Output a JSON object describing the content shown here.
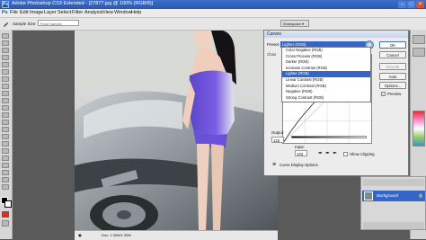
{
  "window": {
    "title": "Adobe Photoshop CS3 Extended - [27877.jpg @ 100% (RGB/8)]"
  },
  "menu": [
    "File",
    "Edit",
    "Image",
    "Layer",
    "Select",
    "Filter",
    "Analysis",
    "View",
    "Window",
    "Help"
  ],
  "options_bar": {
    "sample_size_label": "Sample Size:",
    "sample_size_value": "Point Sample",
    "workspace_label": "Workspace ▾"
  },
  "status_bar": {
    "doc_label": "Doc: 1.30M/1.30M"
  },
  "curves": {
    "title": "Curves",
    "preset_label": "Preset:",
    "preset_value": "Lighter (RGB)",
    "channel_label": "Chan",
    "preset_options": [
      "Color Negative (RGB)",
      "Cross Process (RGB)",
      "Darker (RGB)",
      "Increase Contrast (RGB)",
      "Lighter (RGB)",
      "Linear Contrast (RGB)",
      "Medium Contrast (RGB)",
      "Negative (RGB)",
      "Strong Contrast (RGB)"
    ],
    "selected_preset_index": 4,
    "buttons": {
      "ok": "OK",
      "cancel": "Cancel",
      "smooth": "Smooth",
      "auto": "Auto",
      "options": "Options..."
    },
    "preview_label": "Preview",
    "preview_checked": true,
    "output_label": "Output:",
    "output_value": "125",
    "input_label": "Input:",
    "input_value": "103",
    "show_clipping_label": "Show Clipping",
    "display_options_label": "Curve Display Options"
  },
  "layers": {
    "layer_name": "Background"
  },
  "colors": {
    "selection_blue": "#3466c8",
    "titlebar_blue": "#2b57b0"
  }
}
